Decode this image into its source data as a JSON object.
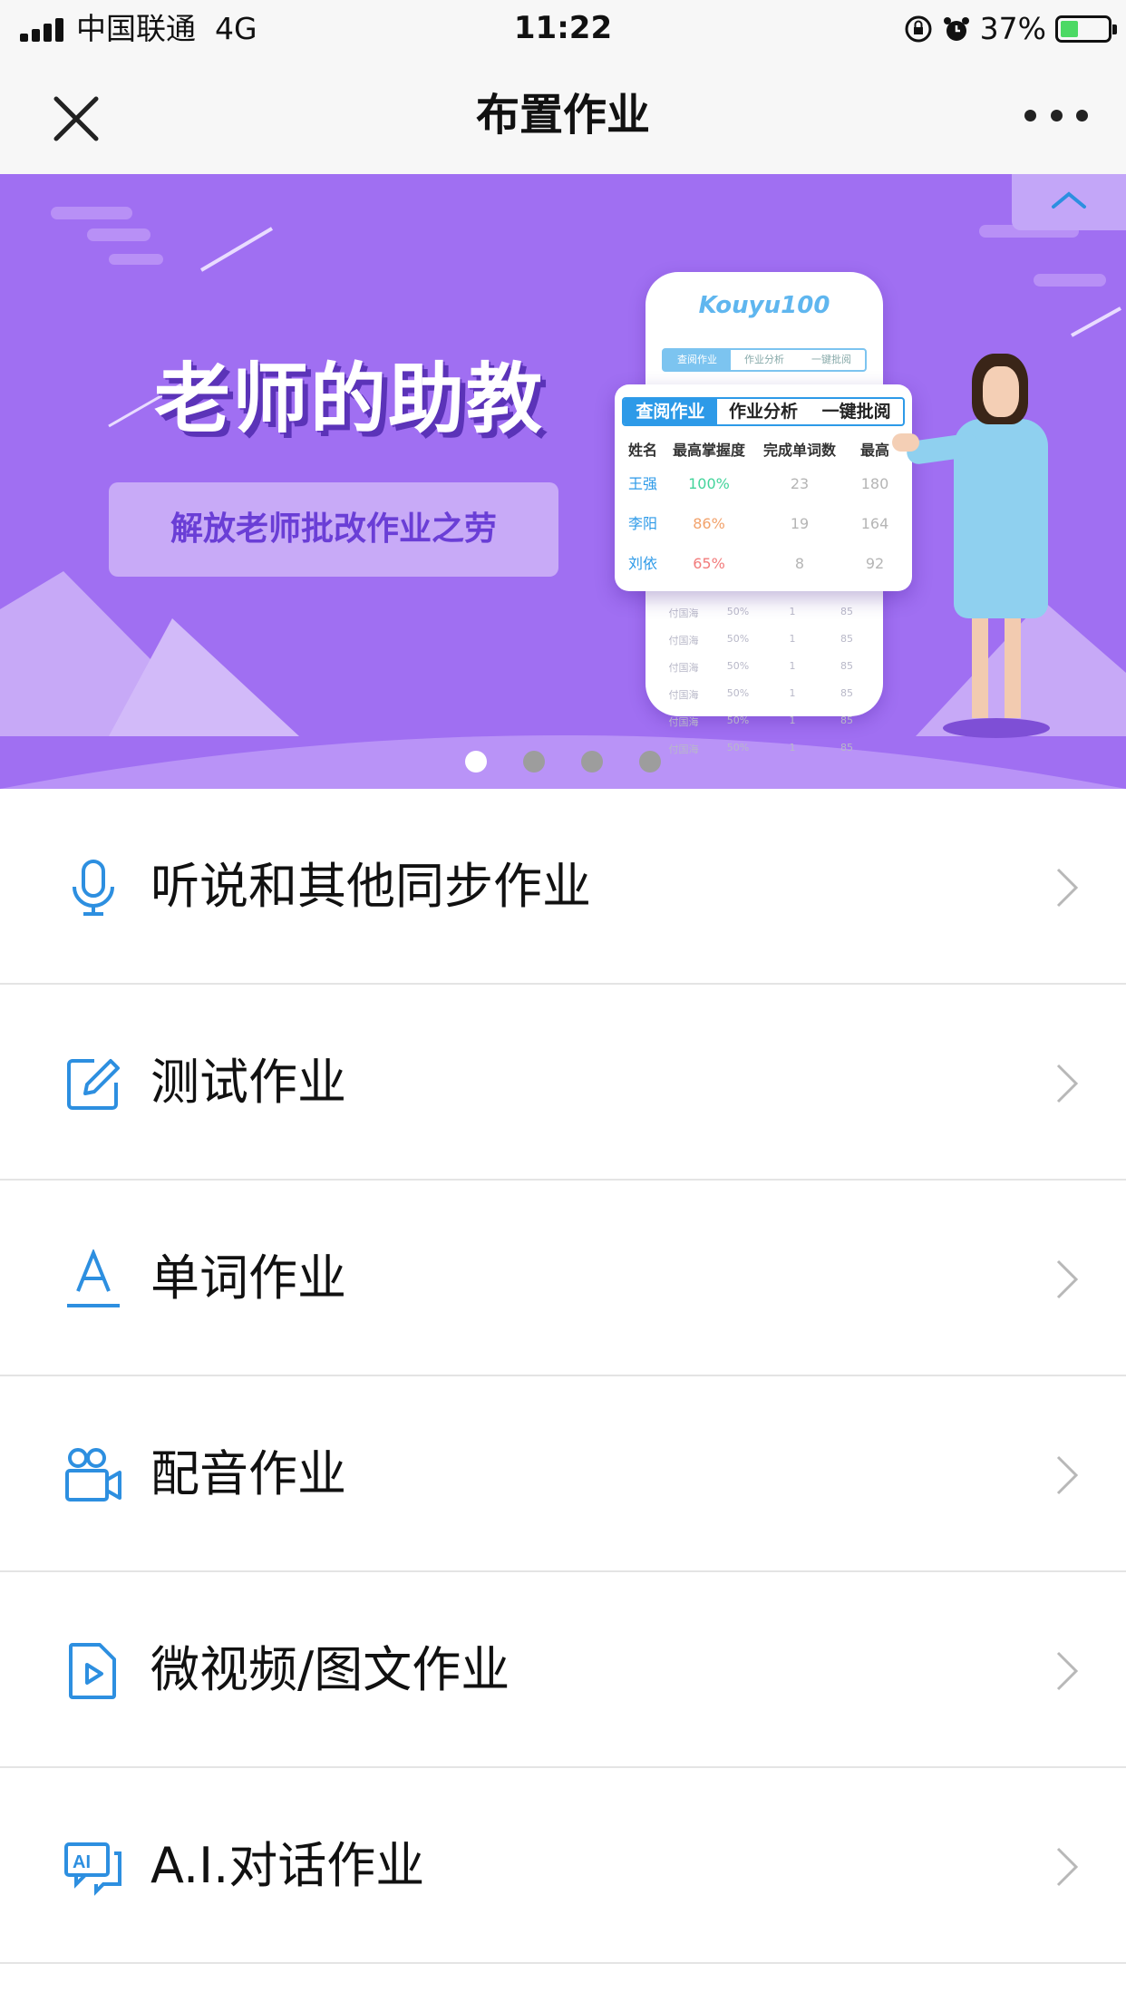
{
  "status_bar": {
    "carrier": "中国联通",
    "network": "4G",
    "time": "11:22",
    "battery": "37%",
    "battery_level": 0.37
  },
  "nav": {
    "title": "布置作业",
    "close_icon": "close-icon",
    "more_icon": "more-icon"
  },
  "banner": {
    "headline": "老师的助教",
    "subtitle": "解放老师批改作业之劳",
    "brand": "Kouyu100",
    "mini_tabs": [
      "查阅作业",
      "作业分析",
      "一键批阅"
    ],
    "card": {
      "tabs": [
        "查阅作业",
        "作业分析",
        "一键批阅"
      ],
      "headers": [
        "姓名",
        "最高掌握度",
        "完成单词数",
        "最高"
      ],
      "rows": [
        {
          "name": "王强",
          "mastery": "100%",
          "words": "23",
          "top": "180"
        },
        {
          "name": "李阳",
          "mastery": "86%",
          "words": "19",
          "top": "164"
        },
        {
          "name": "刘依",
          "mastery": "65%",
          "words": "8",
          "top": "92"
        }
      ]
    },
    "ghost_rows": [
      [
        "付国海",
        "50%",
        "1",
        "85"
      ],
      [
        "付国海",
        "50%",
        "1",
        "85"
      ],
      [
        "付国海",
        "50%",
        "1",
        "85"
      ],
      [
        "付国海",
        "50%",
        "1",
        "85"
      ],
      [
        "付国海",
        "50%",
        "1",
        "85"
      ],
      [
        "付国海",
        "50%",
        "1",
        "85"
      ]
    ],
    "active_page": 0,
    "page_count": 4
  },
  "menu": [
    {
      "label": "听说和其他同步作业",
      "icon": "microphone-icon"
    },
    {
      "label": "测试作业",
      "icon": "edit-icon"
    },
    {
      "label": "单词作业",
      "icon": "letter-a-icon"
    },
    {
      "label": "配音作业",
      "icon": "video-camera-icon"
    },
    {
      "label": "微视频/图文作业",
      "icon": "video-file-icon"
    },
    {
      "label": "A.I.对话作业",
      "icon": "ai-chat-icon"
    }
  ],
  "colors": {
    "accent": "#2d8fe0",
    "banner_bg": "#a06ff2",
    "divider": "#e4e4e4"
  }
}
